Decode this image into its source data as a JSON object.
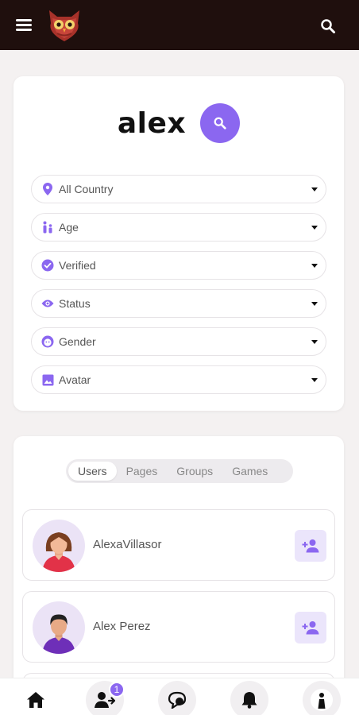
{
  "search": {
    "query": "alex"
  },
  "filters": [
    {
      "label": "All Country",
      "icon": "location-pin-icon"
    },
    {
      "label": "Age",
      "icon": "people-icon"
    },
    {
      "label": "Verified",
      "icon": "verified-check-icon"
    },
    {
      "label": "Status",
      "icon": "eye-icon"
    },
    {
      "label": "Gender",
      "icon": "face-icon"
    },
    {
      "label": "Avatar",
      "icon": "image-icon"
    }
  ],
  "tabs": [
    {
      "label": "Users",
      "active": true
    },
    {
      "label": "Pages",
      "active": false
    },
    {
      "label": "Groups",
      "active": false
    },
    {
      "label": "Games",
      "active": false
    }
  ],
  "results": [
    {
      "name": "AlexaVillasor"
    },
    {
      "name": "Alex Perez"
    }
  ],
  "nav": {
    "friend_requests_badge": "1"
  },
  "colors": {
    "accent": "#8b67f0",
    "topbar": "#1f0f0d",
    "background": "#f4f1f1"
  }
}
